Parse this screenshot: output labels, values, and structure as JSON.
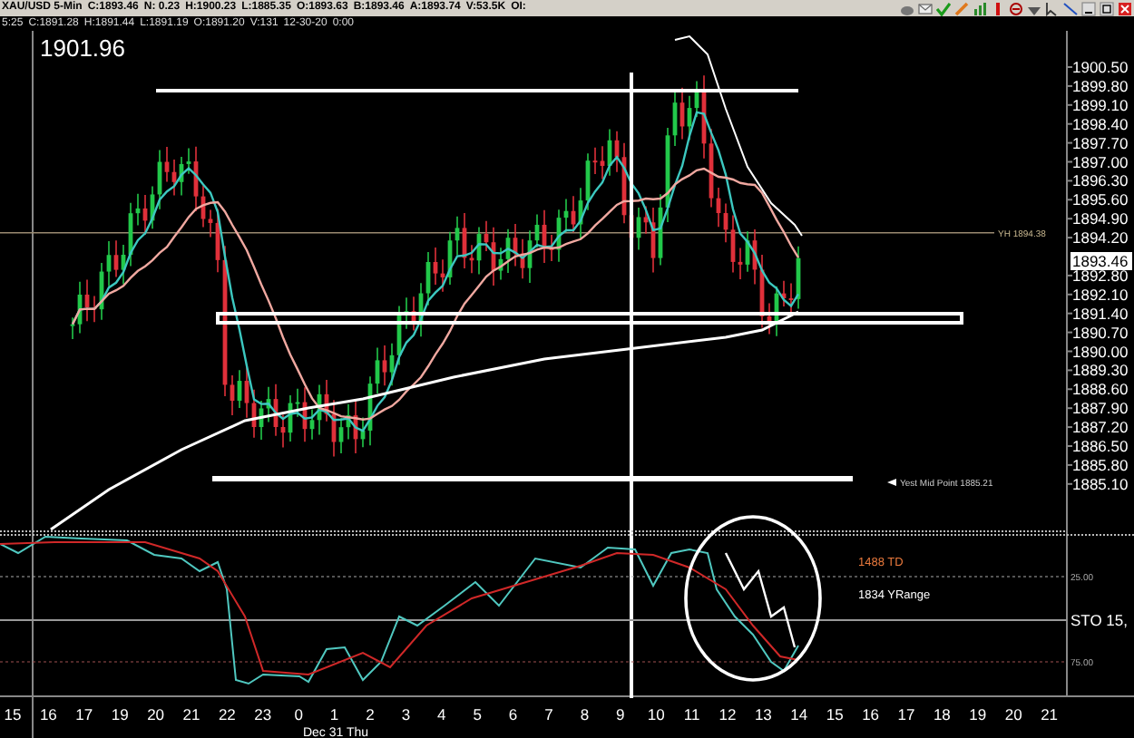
{
  "title_bar": {
    "items": [
      "XAU/USD 5-Min",
      "C:1893.46",
      "N: 0.23",
      "H:1900.23",
      "L:1885.35",
      "O:1893.63",
      "B:1893.46",
      "A:1893.74",
      "V:53.5K",
      "OI:"
    ]
  },
  "info_bar": {
    "items": [
      "5:25",
      "C:1891.28",
      "H:1891.44",
      "L:1891.19",
      "O:1891.20",
      "V:131",
      "12-30-20",
      "0:00"
    ]
  },
  "price_chart": {
    "title": "1901.96",
    "price_axis": [
      "1900.50",
      "1899.80",
      "1899.10",
      "1898.40",
      "1897.70",
      "1897.00",
      "1896.30",
      "1895.60",
      "1894.90",
      "1894.20",
      "1892.80",
      "1892.10",
      "1891.40",
      "1890.70",
      "1890.00",
      "1889.30",
      "1888.60",
      "1887.90",
      "1887.20",
      "1886.50",
      "1885.80",
      "1885.10"
    ],
    "current_price": "1893.46",
    "annotations": [
      {
        "kind": "line_label",
        "text": "YH 1894.38"
      },
      {
        "kind": "arrow_label",
        "text": "Yest Mid Point 1885.21"
      }
    ]
  },
  "indicator": {
    "name": "STO 15,",
    "levels": [
      "25.00",
      "75.00"
    ],
    "labels": [
      {
        "text": "1488 TD",
        "color": "#e8783c"
      },
      {
        "text": "1834 YRange",
        "color": "#ffffff"
      }
    ]
  },
  "time_axis": {
    "labels": [
      "15",
      "16",
      "17",
      "19",
      "20",
      "21",
      "22",
      "23",
      "0",
      "1",
      "2",
      "3",
      "4",
      "5",
      "6",
      "7",
      "8",
      "9",
      "10",
      "11",
      "12",
      "13",
      "14",
      "15",
      "16",
      "17",
      "18",
      "19",
      "20",
      "21"
    ],
    "date": "Dec 31 Thu"
  }
}
